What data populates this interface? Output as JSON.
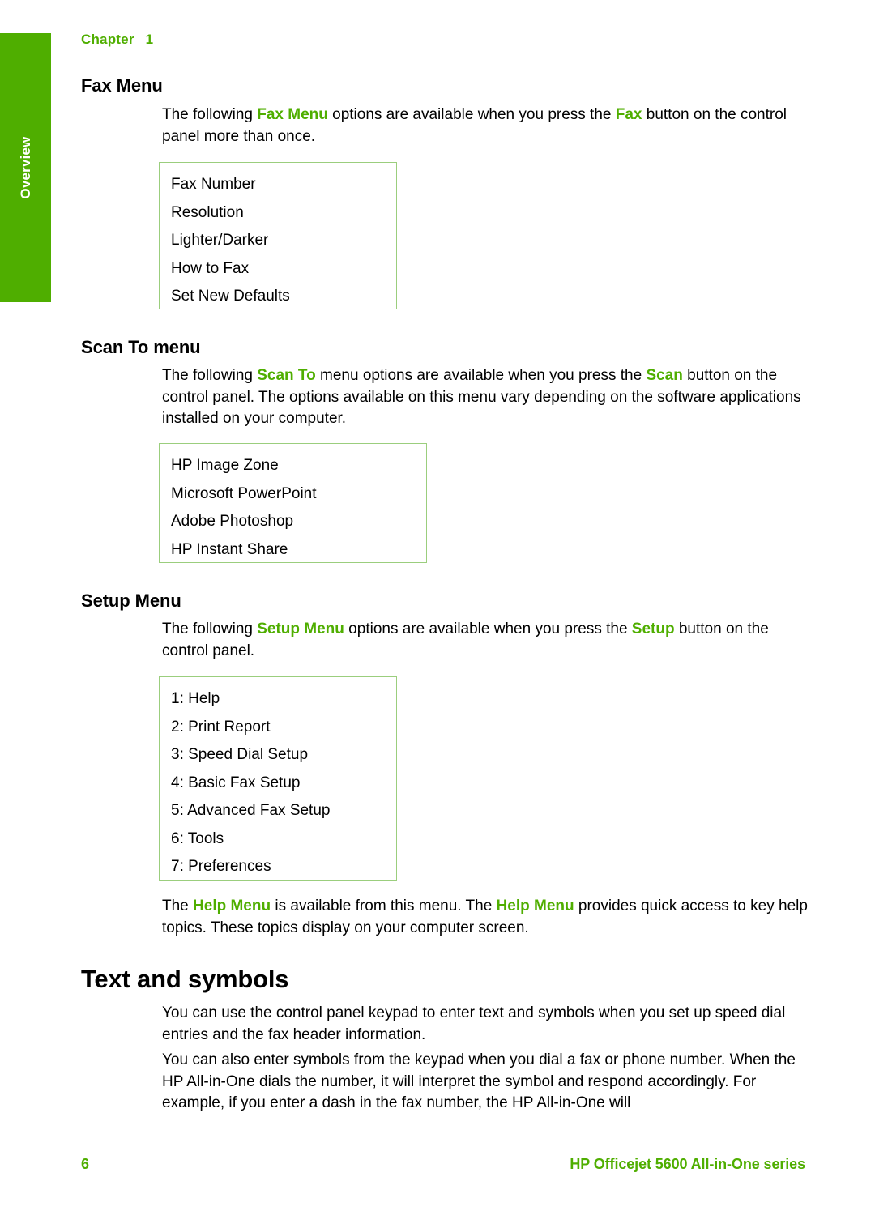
{
  "colors": {
    "brand_green": "#4FAE00",
    "box_border_green": "#9BCE7D",
    "text_black": "#000000",
    "page_background": "#ffffff"
  },
  "side_tab": {
    "label": "Overview"
  },
  "header": {
    "chapter_word": "Chapter",
    "chapter_number": "1"
  },
  "sections": [
    {
      "heading": "Fax Menu",
      "paragraph": {
        "part1": "The following ",
        "hl1": "Fax Menu",
        "part2": " options are available when you press the ",
        "hl2": "Fax",
        "part3": " button on the control panel more than once."
      },
      "box_items": [
        "Fax Number",
        "Resolution",
        "Lighter/Darker",
        "How to Fax",
        "Set New Defaults"
      ]
    },
    {
      "heading": "Scan To menu",
      "paragraph": {
        "part1": "The following ",
        "hl1": "Scan To",
        "part2": " menu options are available when you press the ",
        "hl2": "Scan",
        "part3": " button on the control panel. The options available on this menu vary depending on the software applications installed on your computer."
      },
      "box_items": [
        "HP Image Zone",
        "Microsoft PowerPoint",
        "Adobe Photoshop",
        "HP Instant Share"
      ]
    },
    {
      "heading": "Setup Menu",
      "paragraph": {
        "part1": "The following ",
        "hl1": "Setup Menu",
        "part2": " options are available when you press the ",
        "hl2": "Setup",
        "part3": " button on the control panel."
      },
      "box_items": [
        "1: Help",
        "2: Print Report",
        "3: Speed Dial Setup",
        "4: Basic Fax Setup",
        "5: Advanced Fax Setup",
        "6: Tools",
        "7: Preferences"
      ],
      "after_box_paragraph": {
        "part1": "The ",
        "hl1": "Help Menu",
        "part2": " is available from this menu. The ",
        "hl2": "Help Menu",
        "part3": " provides quick access to key help topics. These topics display on your computer screen."
      }
    }
  ],
  "text_and_symbols": {
    "heading": "Text and symbols",
    "paragraph_1": "You can use the control panel keypad to enter text and symbols when you set up speed dial entries and the fax header information.",
    "paragraph_2": "You can also enter symbols from the keypad when you dial a fax or phone number. When the HP All-in-One dials the number, it will interpret the symbol and respond accordingly. For example, if you enter a dash in the fax number, the HP All-in-One will"
  },
  "footer": {
    "page_number": "6",
    "product_name": "HP Officejet 5600 All-in-One series"
  }
}
